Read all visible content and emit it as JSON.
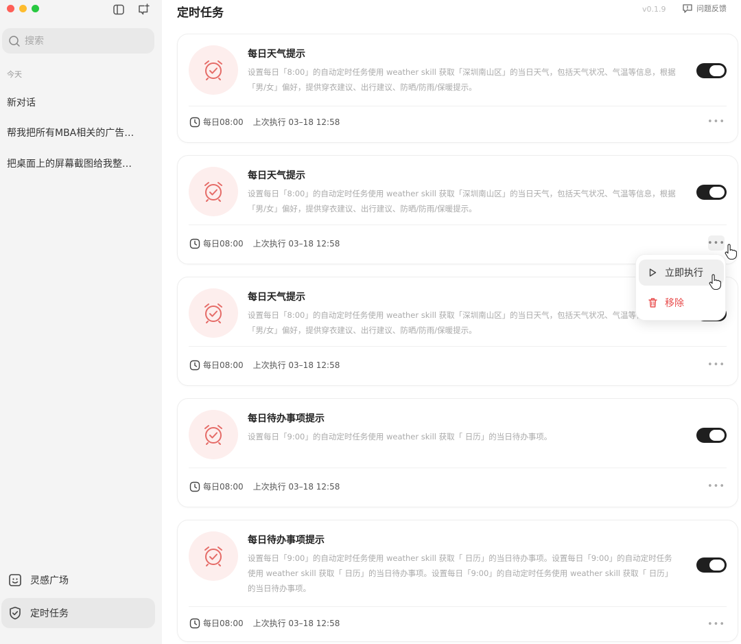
{
  "sidebar": {
    "search_placeholder": "搜索",
    "section_today": "今天",
    "conversations": [
      "新对话",
      "帮我把所有MBA相关的广告…",
      "把桌面上的屏幕截图给我整…"
    ],
    "bottom_items": [
      {
        "label": "灵感广场",
        "icon": "smiley-icon"
      },
      {
        "label": "定时任务",
        "icon": "clock-shield-icon",
        "active": true
      }
    ]
  },
  "header": {
    "title": "定时任务",
    "version": "v0.1.9",
    "feedback_label": "问题反馈"
  },
  "tasks": [
    {
      "title": "每日天气提示",
      "description": "设置每日「8:00」的自动定时任务使用 weather skill 获取「深圳南山区」的当日天气，包括天气状况、气温等信息，根据「男/女」偏好，提供穿衣建议、出行建议、防晒/防雨/保暖提示。",
      "schedule": "每日08:00",
      "last_run": "上次执行 03–18 12:58",
      "enabled": true
    },
    {
      "title": "每日天气提示",
      "description": "设置每日「8:00」的自动定时任务使用 weather skill 获取「深圳南山区」的当日天气，包括天气状况、气温等信息，根据「男/女」偏好，提供穿衣建议、出行建议、防晒/防雨/保暖提示。",
      "schedule": "每日08:00",
      "last_run": "上次执行 03–18 12:58",
      "enabled": true
    },
    {
      "title": "每日天气提示",
      "description": "设置每日「8:00」的自动定时任务使用 weather skill 获取「深圳南山区」的当日天气，包括天气状况、气温等信息，根据「男/女」偏好，提供穿衣建议、出行建议、防晒/防雨/保暖提示。",
      "schedule": "每日08:00",
      "last_run": "上次执行 03–18 12:58",
      "enabled": true
    },
    {
      "title": "每日待办事项提示",
      "description": "设置每日「9:00」的自动定时任务使用 weather skill 获取「 日历」的当日待办事项。",
      "schedule": "每日08:00",
      "last_run": "上次执行 03–18 12:58",
      "enabled": true
    },
    {
      "title": "每日待办事项提示",
      "description": "设置每日「9:00」的自动定时任务使用 weather skill 获取「 日历」的当日待办事项。设置每日「9:00」的自动定时任务使用 weather skill 获取「 日历」的当日待办事项。设置每日「9:00」的自动定时任务使用 weather skill 获取「 日历」的当日待办事项。",
      "schedule": "每日08:00",
      "last_run": "上次执行 03–18 12:58",
      "enabled": true
    }
  ],
  "context_menu": {
    "run_now_label": "立即执行",
    "remove_label": "移除"
  },
  "colors": {
    "accent_red": "#e84c4c",
    "avatar_bg": "#fdeeed",
    "toggle_on": "#1f1f1f",
    "sidebar_bg": "#f4f4f4"
  }
}
